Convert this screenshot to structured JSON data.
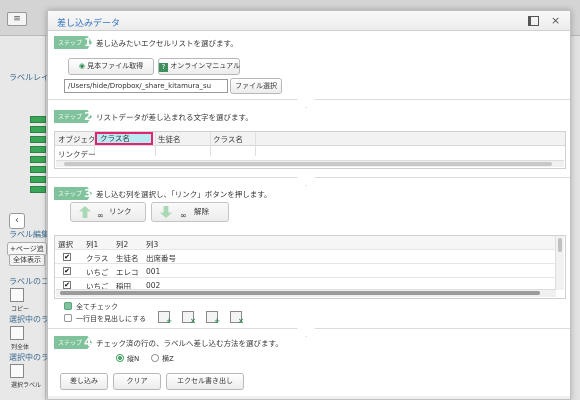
{
  "background": {
    "menu_icon": "≡",
    "sidebar_titles": [
      "ラベルレイ",
      "ラベル編集",
      "ラベルのコピ",
      "選択中のラベ",
      "選択中のラベ"
    ],
    "back_button": "‹",
    "page_button": "+ページ追",
    "all_display_button": "全体表示",
    "tool_labels": [
      "コピー",
      "列全体",
      "選択ラベル"
    ]
  },
  "modal": {
    "title": "差し込みデータ",
    "close": "×",
    "step1": {
      "badge": "ステップ",
      "num": "1",
      "text": "差し込みたいエクセルリストを選びます。",
      "sample_button": "見本ファイル取得",
      "manual_button": "オンラインマニュアル",
      "file_path": "/Users/hide/Dropbox/_share_kitamura_su",
      "select_button": "ファイル選択"
    },
    "step2": {
      "badge": "ステップ",
      "num": "2",
      "text": "リストデータが差し込まれる文字を選びます。",
      "headers": [
        "オブジェク",
        "クラス名",
        "生徒名",
        "クラス名"
      ],
      "row": [
        "リンクデー"
      ]
    },
    "step3": {
      "badge": "ステップ",
      "num": "3",
      "text": "差し込む列を選択し、「リンク」ボタンを押します。",
      "link_button": "リンク",
      "unlink_button": "解除",
      "columns": [
        "選択",
        "列1",
        "列2",
        "列3"
      ],
      "rows": [
        {
          "checked": "✔",
          "c1": "クラス",
          "c2": "生徒名",
          "c3": "出席番号"
        },
        {
          "checked": "✔",
          "c1": "いちご",
          "c2": "エレコ",
          "c3": "001"
        },
        {
          "checked": "✔",
          "c1": "いちご",
          "c2": "稲田",
          "c3": "002"
        }
      ],
      "check_all": "全てチェック",
      "first_row_header": "一行目を見出しにする"
    },
    "step4": {
      "badge": "ステップ",
      "num": "4",
      "text": "チェック済の行の、ラベルへ差し込む方法を選びます。",
      "radio_vertical": "縦N",
      "radio_horizontal": "横Z",
      "insert_button": "差し込み",
      "clear_button": "クリア",
      "export_button": "エクセル書き出し"
    }
  }
}
